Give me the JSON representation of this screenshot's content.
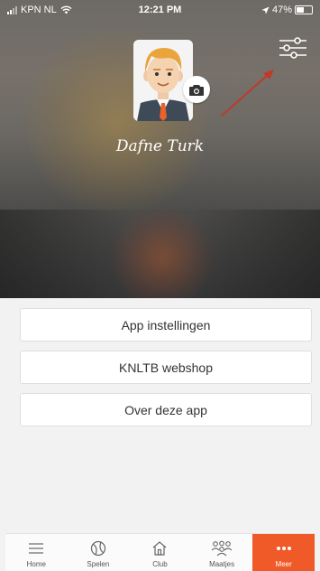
{
  "status_bar": {
    "carrier": "KPN NL",
    "time": "12:21 PM",
    "battery": "47%",
    "battery_level": 0.47
  },
  "profile": {
    "name": "Dafne Turk"
  },
  "menu": {
    "items": [
      {
        "label": "App instellingen"
      },
      {
        "label": "KNLTB webshop"
      },
      {
        "label": "Over deze app"
      }
    ]
  },
  "tabbar": {
    "items": [
      {
        "label": "Home",
        "icon": "menu-icon"
      },
      {
        "label": "Spelen",
        "icon": "tennis-ball-icon"
      },
      {
        "label": "Club",
        "icon": "house-icon"
      },
      {
        "label": "Maatjes",
        "icon": "people-icon"
      },
      {
        "label": "Meer",
        "icon": "more-dots-icon",
        "active": true
      }
    ]
  },
  "colors": {
    "accent": "#f05a28",
    "annotation_arrow": "#c0392b"
  }
}
